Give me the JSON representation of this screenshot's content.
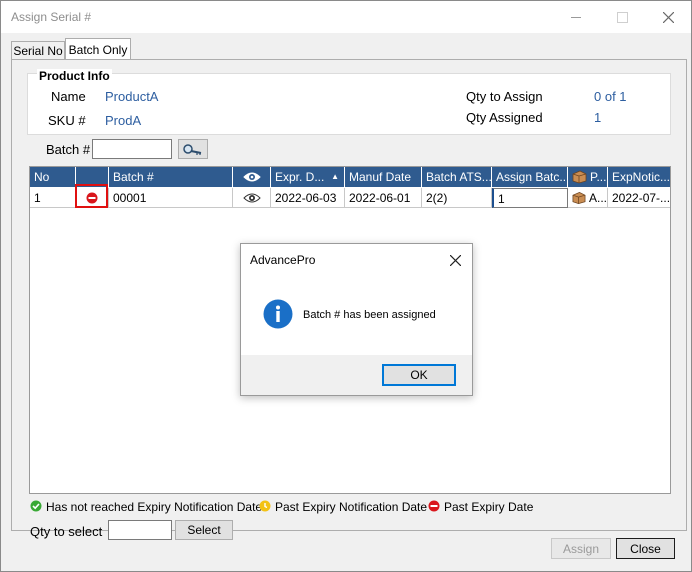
{
  "window": {
    "title": "Assign Serial #"
  },
  "tabs": [
    {
      "label": "Serial No"
    },
    {
      "label": "Batch Only"
    }
  ],
  "product_info": {
    "heading": "Product  Info",
    "name_label": "Name",
    "name_value": "ProductA",
    "sku_label": "SKU #",
    "sku_value": "ProdA",
    "qty_to_assign_label": "Qty to Assign",
    "qty_to_assign_value": "0 of 1",
    "qty_assigned_label": "Qty Assigned",
    "qty_assigned_value": "1"
  },
  "batch_search": {
    "label": "Batch #",
    "value": ""
  },
  "grid": {
    "headers": [
      "No",
      "",
      "Batch #",
      "",
      "Expr. D...",
      "Manuf Date",
      "Batch ATS...",
      "Assign Batc...",
      "P...",
      "ExpNotic..."
    ],
    "rows": [
      {
        "no": "1",
        "batch": "00001",
        "expr": "2022-06-03",
        "manuf": "2022-06-01",
        "ats": "2(2)",
        "assign": "1",
        "p": "A...",
        "expnotice": "2022-07-..."
      }
    ]
  },
  "dialog": {
    "title": "AdvancePro",
    "message": "Batch # has been assigned",
    "ok_label": "OK"
  },
  "legend": {
    "not_reached": "Has not reached Expiry Notification Date",
    "past_notification": "Past Expiry Notification Date",
    "past_expiry": "Past Expiry Date"
  },
  "qty_select": {
    "label": "Qty to select",
    "value": "",
    "button_label": "Select"
  },
  "footer": {
    "assign_label": "Assign",
    "close_label": "Close"
  },
  "colors": {
    "header_bg": "#2f5b8f",
    "link_blue": "#2d5ea0",
    "status_green": "#39a935",
    "status_yellow": "#f3c214",
    "status_red": "#d9161c",
    "highlight_red": "#e01010"
  }
}
